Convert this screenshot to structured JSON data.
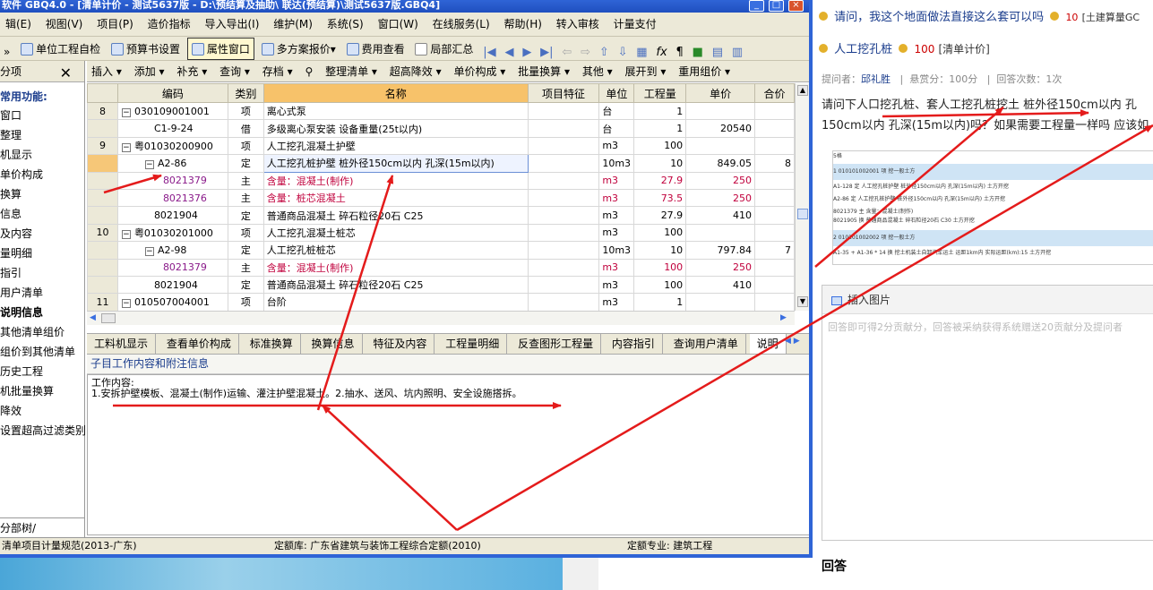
{
  "window": {
    "title": "软件 GBQ4.0 - [清单计价 - 测试5637版 - D:\\预结算及抽助\\ 联达(预结算)\\测试5637版.GBQ4]",
    "controls": [
      "_",
      "□",
      "×"
    ]
  },
  "menu": [
    "辑(E)",
    "视图(V)",
    "项目(P)",
    "造价指标",
    "导入导出(I)",
    "维护(M)",
    "系统(S)",
    "窗口(W)",
    "在线服务(L)",
    "帮助(H)",
    "转入审核",
    "计量支付"
  ],
  "toolbar": {
    "items": [
      "单位工程自检",
      "预算书设置",
      "属性窗口",
      "多方案报价",
      "费用查看",
      "局部汇总"
    ]
  },
  "left_panel": {
    "header": "分项",
    "subheader": "常用功能:",
    "items": [
      "窗口",
      "整理",
      "机显示",
      "单价构成",
      "换算",
      "信息",
      "及内容",
      "量明细",
      "指引",
      "用户清单",
      "说明信息",
      "其他清单组价",
      "组价到其他清单",
      "历史工程",
      "机批量换算",
      "降效",
      "设置超高过滤类别"
    ],
    "bottom": "分部树/"
  },
  "subtoolbar": [
    "插入",
    "添加",
    "补充",
    "查询",
    "存档",
    "整理清单",
    "超高降效",
    "单价构成",
    "批量换算",
    "其他",
    "展开到",
    "重用组价"
  ],
  "table": {
    "headers": [
      "编码",
      "类别",
      "名称",
      "项目特征",
      "单位",
      "工程量",
      "单价",
      "合价"
    ],
    "rows": [
      {
        "n": "8",
        "code": "030109001001",
        "type": "项",
        "name": "离心式泵",
        "unit": "台",
        "qty": "1",
        "price": "",
        "total": "",
        "style": "",
        "pm": "−"
      },
      {
        "n": "",
        "code": "C1-9-24",
        "type": "借",
        "name": "多级离心泵安装 设备重量(25t以内)",
        "unit": "台",
        "qty": "1",
        "price": "20540",
        "total": "",
        "style": "",
        "pm": ""
      },
      {
        "n": "9",
        "code": "粤01030200900",
        "type": "项",
        "name": "人工挖孔混凝土护壁",
        "unit": "m3",
        "qty": "100",
        "price": "",
        "total": "",
        "style": "",
        "pm": "−"
      },
      {
        "n": "",
        "code": "A2-86",
        "type": "定",
        "name": "人工挖孔桩护壁 桩外径150cm以内 孔深(15m以内)",
        "unit": "10m3",
        "qty": "10",
        "price": "849.05",
        "total": "8",
        "style": "sel",
        "pm": "−"
      },
      {
        "n": "",
        "code": "8021379",
        "type": "主",
        "name": "含量：混凝土(制作)",
        "unit": "m3",
        "qty": "27.9",
        "price": "250",
        "total": "",
        "style": "red",
        "pm": ""
      },
      {
        "n": "",
        "code": "8021376",
        "type": "主",
        "name": "含量：桩芯混凝土",
        "unit": "m3",
        "qty": "73.5",
        "price": "250",
        "total": "",
        "style": "red",
        "pm": ""
      },
      {
        "n": "",
        "code": "8021904",
        "type": "定",
        "name": "普通商品混凝土 碎石粒径20石 C25",
        "unit": "m3",
        "qty": "27.9",
        "price": "410",
        "total": "",
        "style": "",
        "pm": ""
      },
      {
        "n": "10",
        "code": "粤01030201000",
        "type": "项",
        "name": "人工挖孔混凝土桩芯",
        "unit": "m3",
        "qty": "100",
        "price": "",
        "total": "",
        "style": "",
        "pm": "−"
      },
      {
        "n": "",
        "code": "A2-98",
        "type": "定",
        "name": "人工挖孔桩桩芯",
        "unit": "10m3",
        "qty": "10",
        "price": "797.84",
        "total": "7",
        "style": "",
        "pm": "−"
      },
      {
        "n": "",
        "code": "8021379",
        "type": "主",
        "name": "含量：混凝土(制作)",
        "unit": "m3",
        "qty": "100",
        "price": "250",
        "total": "",
        "style": "red",
        "pm": ""
      },
      {
        "n": "",
        "code": "8021904",
        "type": "定",
        "name": "普通商品混凝土 碎石粒径20石 C25",
        "unit": "m3",
        "qty": "100",
        "price": "410",
        "total": "",
        "style": "",
        "pm": ""
      },
      {
        "n": "11",
        "code": "010507004001",
        "type": "项",
        "name": "台阶",
        "unit": "m3",
        "qty": "1",
        "price": "",
        "total": "",
        "style": "",
        "pm": "−"
      }
    ]
  },
  "bottom_tabs": [
    "工料机显示",
    "查看单价构成",
    "标准换算",
    "换算信息",
    "特征及内容",
    "工程量明细",
    "反查图形工程量",
    "内容指引",
    "查询用户清单",
    "说明"
  ],
  "info": {
    "title": "子目工作内容和附注信息",
    "line1": "工作内容:",
    "line2": "1.安拆护壁模板、混凝土(制作)运输、灌注护壁混凝土。2.抽水、送风、坑内照明、安全设施搭拆。"
  },
  "status": {
    "left": "清单项目计量规范(2013-广东)",
    "middle": "定额库: 广东省建筑与装饰工程综合定额(2010)",
    "right": "定额专业: 建筑工程"
  },
  "right_panel": {
    "q1_title": "请问，我这个地面做法直接这么套可以吗",
    "q1_points": "10",
    "q1_tag": "[土建算量GC",
    "q2_title": "人工挖孔桩",
    "q2_points": "100",
    "q2_tag": "[清单计价]",
    "meta_prefix": "提问者：",
    "meta_user": "邱礼胜",
    "meta_reward": "悬赏分：100分",
    "meta_count": "回答次数：1次",
    "body_line1": "请问下人口挖孔桩、套人工挖孔桩挖土 桩外径150cm以内 孔",
    "body_line2": "150cm以内 孔深(15m以内)吗？如果需要工程量一样吗 应该如",
    "thumb_rows": [
      {
        "t": "5格"
      },
      {
        "t": "1    010101002001          项    挖一般土方"
      },
      {
        "t": "     A1-128                定    人工挖孔桩护壁 桩外径150cm以内 孔深(15m以内)    土方开挖"
      },
      {
        "t": "     A2-86                 定    人工挖孔桩护壁 桩外径150cm以内 孔深(15m以内)    土方开挖"
      },
      {
        "t": "     8021379               主    含量：混凝土(制作)"
      },
      {
        "t": "     8021905               换    普通商品混凝土 碎石粒径20石 C30    土方开挖"
      },
      {
        "t": "2    010101002002          项    挖一般土方"
      },
      {
        "t": "     A1-35 + A1-36 * 14    换    挖土机装土自卸汽车运土 运距1km内 实际运距(km):15    土方开挖"
      }
    ],
    "insert_image": "插入图片",
    "placeholder": "回答即可得2分贡献分，回答被采纳获得系统赠送20贡献分及提问者",
    "answer_heading": "回答"
  },
  "colors": {
    "accent": "#2f64d6",
    "arrow": "#e41b1b",
    "header_selected": "#f7c26a"
  }
}
